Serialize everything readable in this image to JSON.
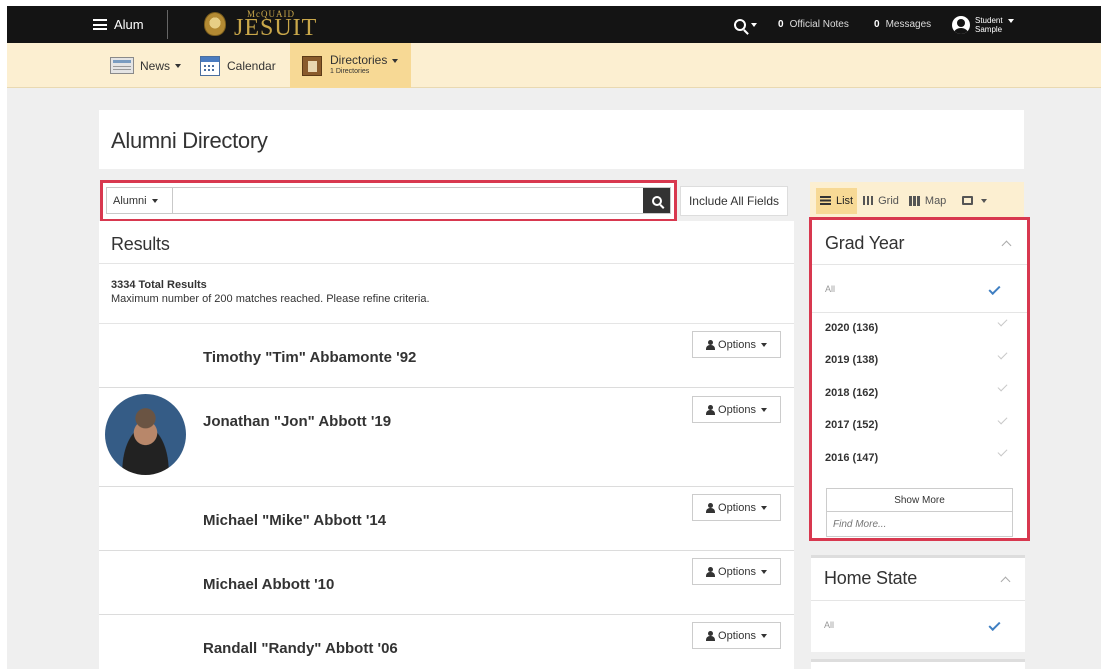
{
  "topbar": {
    "menu_label": "Alum",
    "brand_small": "McQUAID",
    "brand_main": "JESUIT",
    "official_notes": {
      "count": "0",
      "label": "Official Notes"
    },
    "messages": {
      "count": "0",
      "label": "Messages"
    },
    "user": {
      "line1": "Student",
      "line2": "Sample"
    }
  },
  "nav": {
    "news": "News",
    "calendar": "Calendar",
    "directories": "Directories",
    "directories_sub": "1 Directories"
  },
  "page": {
    "title": "Alumni Directory"
  },
  "search": {
    "scope": "Alumni",
    "value": "",
    "placeholder": "",
    "include_all_fields": "Include All Fields"
  },
  "views": {
    "list": "List",
    "grid": "Grid",
    "map": "Map"
  },
  "results": {
    "heading": "Results",
    "total": "3334 Total Results",
    "note": "Maximum number of 200 matches reached. Please refine criteria.",
    "options_label": "Options",
    "people": [
      {
        "name": "Timothy \"Tim\" Abbamonte '92"
      },
      {
        "name": "Jonathan \"Jon\" Abbott '19"
      },
      {
        "name": "Michael \"Mike\" Abbott '14"
      },
      {
        "name": "Michael Abbott '10"
      },
      {
        "name": "Randall \"Randy\" Abbott '06"
      }
    ]
  },
  "filters": {
    "grad_year": {
      "title": "Grad Year",
      "all": "All",
      "options": [
        "2020 (136)",
        "2019 (138)",
        "2018 (162)",
        "2017 (152)",
        "2016 (147)"
      ],
      "show_more": "Show More",
      "find_more_placeholder": "Find More..."
    },
    "home_state": {
      "title": "Home State",
      "all": "All"
    }
  },
  "colors": {
    "topbar": "#141414",
    "nav_bg": "#fcefd1",
    "nav_active": "#f7d995",
    "highlight_box": "#d8384f",
    "check_blue": "#3f7fc2",
    "brand_gold": "#c9a74a"
  }
}
